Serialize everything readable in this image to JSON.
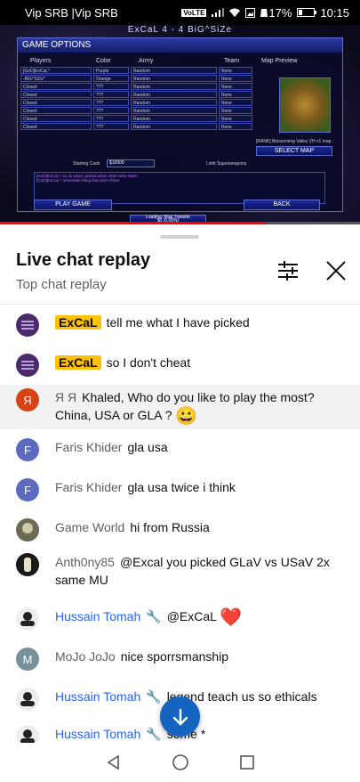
{
  "status_bar": {
    "carrier": "Vip SRB |Vip SRB",
    "volte": "VoLTE",
    "battery_percent": "17%",
    "battery_level": 0.17,
    "time": "10:15",
    "icons": [
      "signal-icon",
      "wifi-icon",
      "image-icon",
      "app-notification-icon"
    ]
  },
  "video": {
    "game_title": "ExCaL 4 - 4 BiG^SiZe",
    "panel_title": "GAME OPTIONS",
    "columns": {
      "players": "Players",
      "color": "Color",
      "army": "Army",
      "team": "Team",
      "map_preview": "Map Preview"
    },
    "slots": [
      {
        "player": "[GoD]ExCaL*",
        "color": "Purple",
        "army": "Random",
        "team": "None"
      },
      {
        "player": "-BiG^SiZe*",
        "color": "Orange",
        "army": "Random",
        "team": "None"
      },
      {
        "player": "Closed",
        "color": "???",
        "army": "Random",
        "team": "None"
      },
      {
        "player": "Closed",
        "color": "???",
        "army": "Random",
        "team": "None"
      },
      {
        "player": "Closed",
        "color": "???",
        "army": "Random",
        "team": "None"
      },
      {
        "player": "Closed",
        "color": "???",
        "army": "Random",
        "team": "None"
      },
      {
        "player": "Closed",
        "color": "???",
        "army": "Random",
        "team": "None"
      },
      {
        "player": "Closed",
        "color": "???",
        "army": "Random",
        "team": "None"
      }
    ],
    "map_name": "[RANK] Blossoming Valley ZH v1 map",
    "select_map": "SELECT MAP",
    "starting_cash_label": "Starting Cash",
    "starting_cash_value": "$10000",
    "superweapons_label": "Limit Superweapons",
    "chat_log": [
      "[GoD]ExCaL*: so ok what i picked when other wins start!!",
      "[GoD]ExCaL*: remember thing that don't cheat"
    ],
    "play_game": "PLAY GAME",
    "back": "BACK",
    "footer_strip": "Loading: Map Transfer",
    "footer_progress": "$0 (0.00%)",
    "playback_progress": 0.74
  },
  "sheet": {
    "title": "Live chat replay",
    "subtitle": "Top chat replay",
    "filter_icon": "tune-icon",
    "close_icon": "close-icon"
  },
  "messages": [
    {
      "author": "ExCaL",
      "badge": "owner",
      "text": "tell me what I have picked",
      "avatar_color": "#4a2a6a",
      "avatar_letter": ""
    },
    {
      "author": "ExCaL",
      "badge": "owner",
      "text": "so I don't cheat",
      "avatar_color": "#4a2a6a",
      "avatar_letter": ""
    },
    {
      "author": "Я Я",
      "badge": "",
      "text": "Khaled, Who do you like to play the most? China, USA or GLA ?",
      "emoji": "😀",
      "avatar_color": "#d84315",
      "avatar_letter": "Я",
      "paid": true
    },
    {
      "author": "Faris Khider",
      "badge": "",
      "text": "gla usa",
      "avatar_color": "#5c6bc0",
      "avatar_letter": "F"
    },
    {
      "author": "Faris Khider",
      "badge": "",
      "text": "gla usa twice i think",
      "avatar_color": "#5c6bc0",
      "avatar_letter": "F"
    },
    {
      "author": "Game World",
      "badge": "",
      "text": "hi from Russia",
      "avatar_color": "#8d8a6a",
      "avatar_letter": ""
    },
    {
      "author": "Anth0ny85",
      "badge": "",
      "text": "@Excal you picked GLaV vs USaV 2x same MU",
      "avatar_color": "#222222",
      "avatar_letter": ""
    },
    {
      "author": "Hussain Tomah",
      "badge": "member",
      "text": "@ExCaL",
      "emoji": "❤️",
      "avatar_color": "#eeeeee",
      "avatar_letter": ""
    },
    {
      "author": "MoJo JoJo",
      "badge": "",
      "text": "nice sporrsmanship",
      "avatar_color": "#78909c",
      "avatar_letter": "M"
    },
    {
      "author": "Hussain Tomah",
      "badge": "member",
      "text": "legend teach us so ethicals",
      "avatar_color": "#eeeeee",
      "avatar_letter": ""
    },
    {
      "author": "Hussain Tomah",
      "badge": "member",
      "text": "some *",
      "avatar_color": "#eeeeee",
      "avatar_letter": ""
    }
  ],
  "scroll_down_icon": "arrow-down-icon",
  "nav": {
    "back_icon": "nav-back-icon",
    "home_icon": "nav-home-icon",
    "recents_icon": "nav-recents-icon"
  }
}
